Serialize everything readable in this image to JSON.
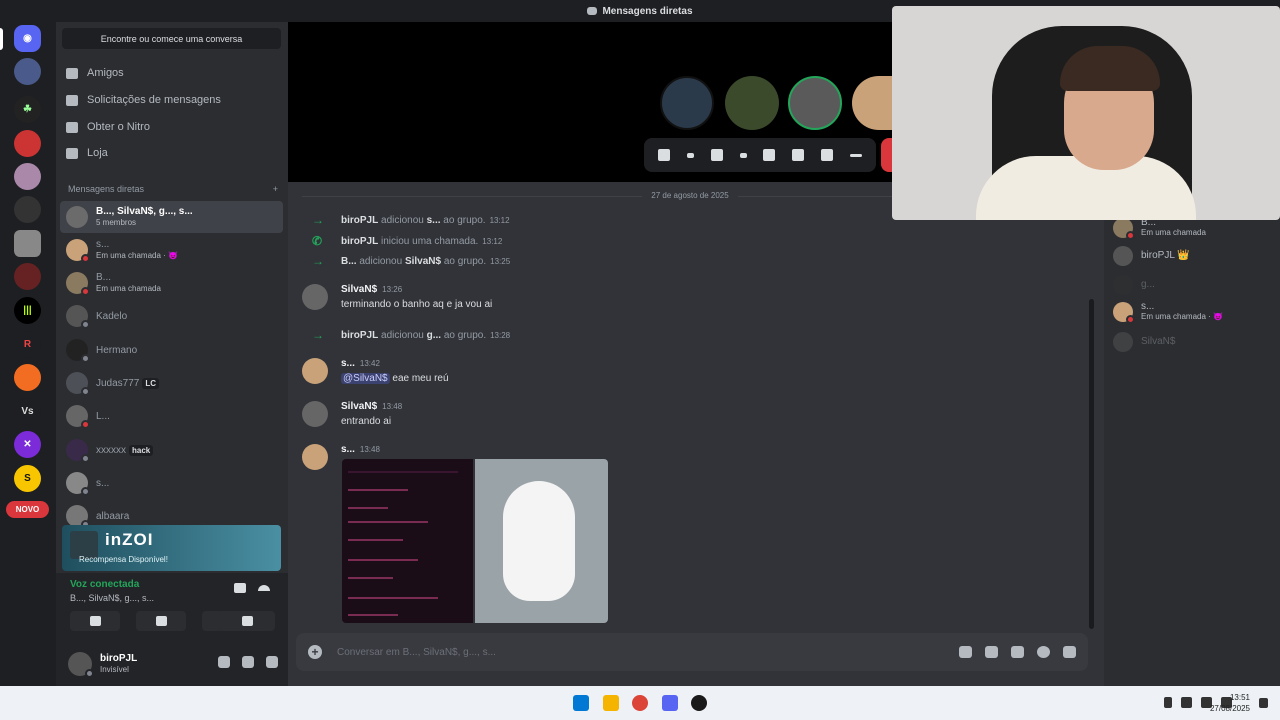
{
  "window": {
    "title": "Mensagens diretas"
  },
  "sidebar": {
    "find_button": "Encontre ou comece uma conversa",
    "nav": [
      {
        "label": "Amigos",
        "icon": "friends-icon"
      },
      {
        "label": "Solicitações de mensagens",
        "icon": "mail-icon"
      },
      {
        "label": "Obter o Nitro",
        "icon": "nitro-icon"
      },
      {
        "label": "Loja",
        "icon": "shop-icon"
      }
    ],
    "dm_header": "Mensagens diretas",
    "dm_add": "+",
    "dms": [
      {
        "name": "B..., SilvaN$, g..., s...",
        "sub": "5 membros",
        "status": ""
      },
      {
        "name": "s...",
        "sub": "Em uma chamada · 😈",
        "status": "dnd"
      },
      {
        "name": "B...",
        "sub": "Em uma chamada",
        "status": "dnd"
      },
      {
        "name": "Kadelo",
        "sub": "",
        "status": "offline"
      },
      {
        "name": "Hermano",
        "sub": "",
        "status": "offline"
      },
      {
        "name": "Judas777",
        "sub": "",
        "tag": "LC",
        "status": "offline"
      },
      {
        "name": "L...",
        "sub": "",
        "status": "dnd"
      },
      {
        "name": "xxxxxx",
        "sub": "",
        "tag": "hack",
        "status": "offline"
      },
      {
        "name": "s...",
        "sub": "",
        "status": "offline"
      },
      {
        "name": "albaara",
        "sub": "",
        "status": "offline"
      }
    ],
    "novo_badge": "NOVO",
    "promo": {
      "logo": "inZOI",
      "subtitle": "Recompensa Disponível!"
    },
    "voice": {
      "status": "Voz conectada",
      "channel": "B..., SilvaN$, g..., s..."
    },
    "user": {
      "name": "biroPJL",
      "status": "Invisível"
    }
  },
  "chat": {
    "date_divider": "27 de agosto de 2025",
    "system_messages": [
      {
        "actor": "biroPJL",
        "text": "adicionou",
        "target": "s...",
        "suffix": "ao grupo.",
        "time": "13:12",
        "icon": "arrow-right-icon"
      },
      {
        "actor": "biroPJL",
        "text": "iniciou uma chamada.",
        "target": "",
        "suffix": "",
        "time": "13:12",
        "icon": "phone-icon"
      },
      {
        "actor": "B...",
        "text": "adicionou",
        "target": "SilvaN$",
        "suffix": "ao grupo.",
        "time": "13:25",
        "icon": "arrow-right-icon"
      },
      {
        "actor": "biroPJL",
        "text": "adicionou",
        "target": "g...",
        "suffix": "ao grupo.",
        "time": "13:28",
        "icon": "arrow-right-icon"
      }
    ],
    "messages": [
      {
        "author": "SilvaN$",
        "time": "13:26",
        "text": "terminando o banho aq e ja vou ai"
      },
      {
        "author": "s...",
        "time": "13:42",
        "mention": "@SilvaN$",
        "text": "eae meu reú"
      },
      {
        "author": "SilvaN$",
        "time": "13:48",
        "text": "entrando ai"
      },
      {
        "author": "s...",
        "time": "13:48",
        "text": ""
      }
    ],
    "composer_placeholder": "Conversar em B..., SilvaN$, g..., s..."
  },
  "members": [
    {
      "name": "B...",
      "sub": "Em uma chamada",
      "dim": false
    },
    {
      "name": "biroPJL 👑",
      "sub": "",
      "dim": false
    },
    {
      "name": "g...",
      "sub": "",
      "dim": true
    },
    {
      "name": "s...",
      "sub": "Em uma chamada · 😈",
      "dim": false
    },
    {
      "name": "SilvaN$",
      "sub": "",
      "dim": true
    }
  ],
  "taskbar": {
    "time": "13:51",
    "date": "27/08/2025"
  },
  "colors": {
    "accent": "#5865f2",
    "online": "#23a55a",
    "dnd": "#da373c",
    "bg": "#313338",
    "sidebar": "#2b2d31"
  }
}
